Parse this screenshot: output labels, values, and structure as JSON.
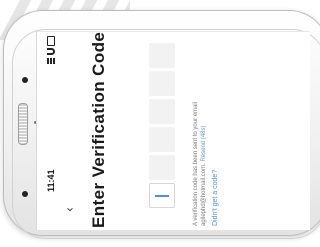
{
  "status_bar": {
    "time": "11:41"
  },
  "icons": {
    "back": "chevron-down-icon",
    "signal": "signal-icon",
    "wifi": "wifi-icon",
    "battery": "battery-icon"
  },
  "verification": {
    "title": "Enter Verification Code",
    "code_box_count": 6,
    "note_line1": "A verification code has been sent to your email",
    "note_line2_email": "agilephd@hotmail.com.",
    "note_line2_resend": "Resend (48s)",
    "didnt_get": "Didn't get a code?"
  },
  "colors": {
    "accent": "#4a90e2",
    "box_fill": "#f2f2f2",
    "title_text": "#1a1a1a",
    "note_text": "#7a7a7a"
  }
}
